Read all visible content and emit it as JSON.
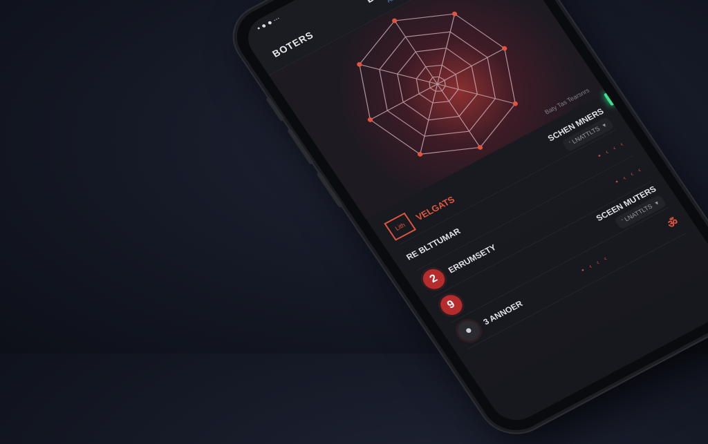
{
  "status_bar": {
    "left": "• ● ● ∙∙∙",
    "right": "■ ▮"
  },
  "header": {
    "left_title": "BOTERS",
    "center_title": "DCHAURE",
    "center_subtitle": "AHMAS"
  },
  "visualization": {
    "caption": "Baty Tas Tearsnrs",
    "accent_color": "#e6413c"
  },
  "panel": {
    "right_title_1": "SCHEN MNERS",
    "right_sub_1": "‘ LNATTLTS",
    "section_title": "VELGATS",
    "section_icon_label": "Lith",
    "item1_label": "RE BLTTUMAR",
    "item1_dots": "• ‹ ‹ ‹",
    "item2_badge": "2",
    "item2_label": "ERRUMSETY",
    "item2_dots": "• ‹ ‹ ‹",
    "right_title_2": "SCEEN MUTERS",
    "right_sub_2": "‘ LNATTLTS",
    "item3_badge": "9",
    "item4_label": "3 ANNOER",
    "item4_dots": "• ‹ ‹ ‹",
    "bottom_icon": "ॐ"
  }
}
